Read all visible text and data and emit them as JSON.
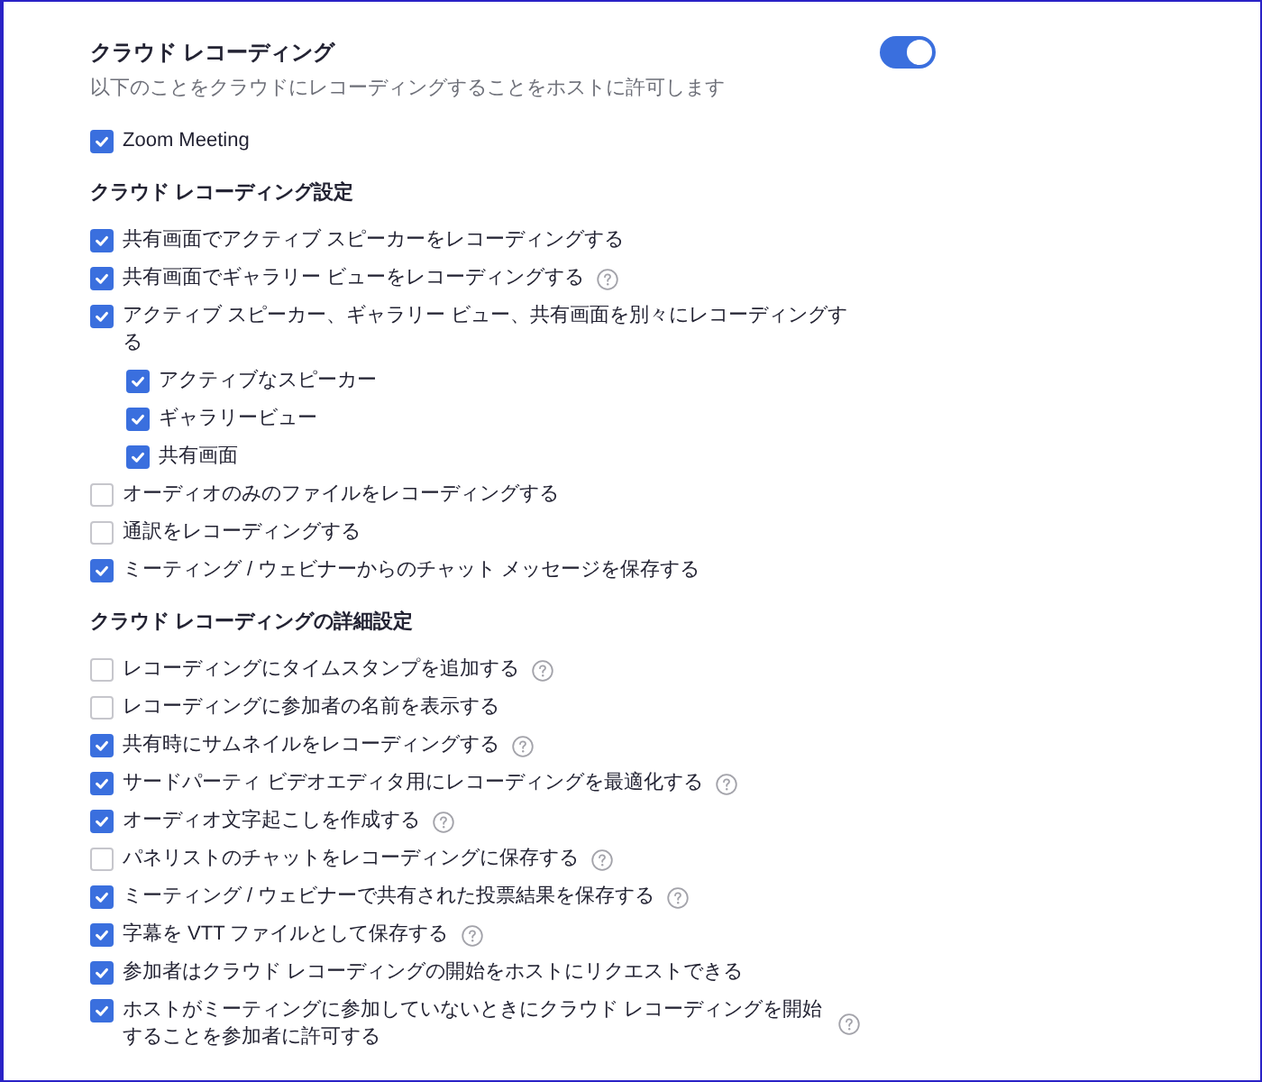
{
  "section": {
    "title": "クラウド レコーディング",
    "description": "以下のことをクラウドにレコーディングすることをホストに許可します",
    "toggle": {
      "on": true
    }
  },
  "options": [
    {
      "label": "Zoom Meeting",
      "checked": true,
      "help": false
    }
  ],
  "groups": [
    {
      "heading": "クラウド レコーディング設定",
      "options": [
        {
          "label": "共有画面でアクティブ スピーカーをレコーディングする",
          "checked": true,
          "help": false
        },
        {
          "label": "共有画面でギャラリー ビューをレコーディングする",
          "checked": true,
          "help": true
        },
        {
          "label": "アクティブ スピーカー、ギャラリー ビュー、共有画面を別々にレコーディングする",
          "checked": true,
          "help": false,
          "children": [
            {
              "label": "アクティブなスピーカー",
              "checked": true,
              "help": false
            },
            {
              "label": "ギャラリービュー",
              "checked": true,
              "help": false
            },
            {
              "label": "共有画面",
              "checked": true,
              "help": false
            }
          ]
        },
        {
          "label": "オーディオのみのファイルをレコーディングする",
          "checked": false,
          "help": false
        },
        {
          "label": "通訳をレコーディングする",
          "checked": false,
          "help": false
        },
        {
          "label": "ミーティング / ウェビナーからのチャット メッセージを保存する",
          "checked": true,
          "help": false
        }
      ]
    },
    {
      "heading": "クラウド レコーディングの詳細設定",
      "options": [
        {
          "label": "レコーディングにタイムスタンプを追加する",
          "checked": false,
          "help": true
        },
        {
          "label": "レコーディングに参加者の名前を表示する",
          "checked": false,
          "help": false
        },
        {
          "label": "共有時にサムネイルをレコーディングする",
          "checked": true,
          "help": true
        },
        {
          "label": "サードパーティ ビデオエディタ用にレコーディングを最適化する",
          "checked": true,
          "help": true
        },
        {
          "label": "オーディオ文字起こしを作成する",
          "checked": true,
          "help": true
        },
        {
          "label": "パネリストのチャットをレコーディングに保存する",
          "checked": false,
          "help": true
        },
        {
          "label": "ミーティング / ウェビナーで共有された投票結果を保存する",
          "checked": true,
          "help": true
        },
        {
          "label": "字幕を VTT ファイルとして保存する",
          "checked": true,
          "help": true
        },
        {
          "label": "参加者はクラウド レコーディングの開始をホストにリクエストできる",
          "checked": true,
          "help": false
        },
        {
          "label": "ホストがミーティングに参加していないときにクラウド レコーディングを開始することを参加者に許可する",
          "checked": true,
          "help": true
        }
      ]
    }
  ]
}
